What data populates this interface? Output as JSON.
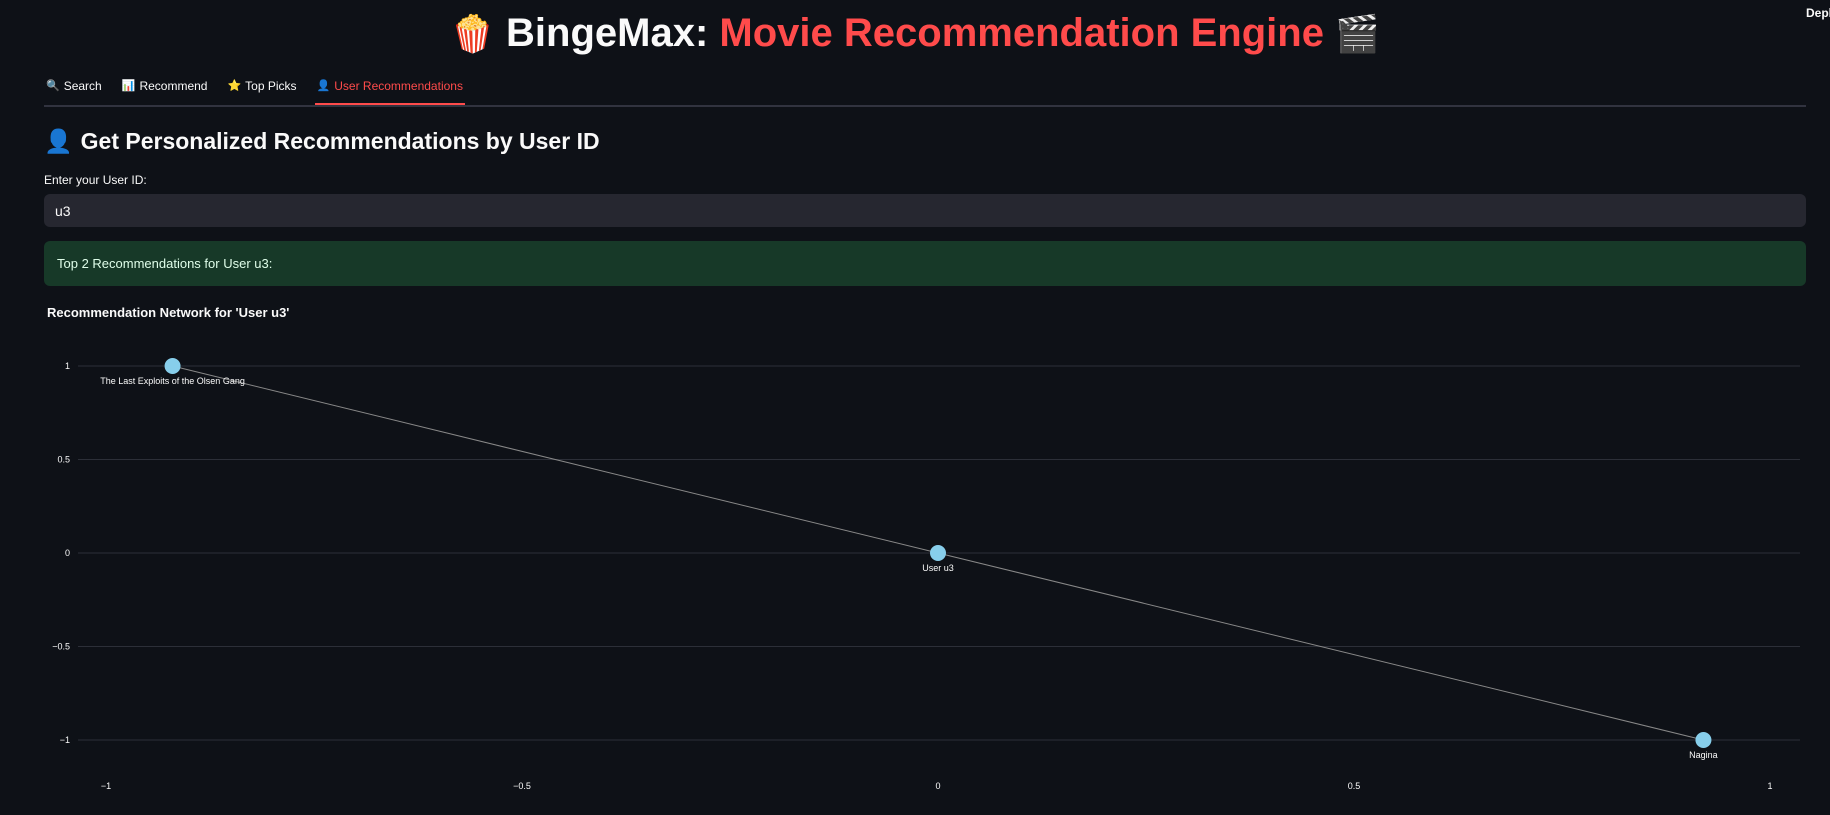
{
  "header": {
    "deploy_label": "Deploy",
    "title_emoji_left": "🍿",
    "title_part1": "BingeMax:",
    "title_part2": "Movie Recommendation Engine",
    "title_emoji_right": "🎬"
  },
  "tabs": [
    {
      "icon": "🔍",
      "label": "Search",
      "active": false
    },
    {
      "icon": "📊",
      "label": "Recommend",
      "active": false
    },
    {
      "icon": "⭐",
      "label": "Top Picks",
      "active": false
    },
    {
      "icon": "👤",
      "label": "User Recommendations",
      "active": true
    }
  ],
  "main": {
    "heading_icon": "👤",
    "heading": "Get Personalized Recommendations by User ID",
    "input_label": "Enter your User ID:",
    "input_value": "u3",
    "success_message": "Top 2 Recommendations for User u3:"
  },
  "colors": {
    "accent": "#ff4b4b",
    "node": "#87ceeb",
    "edge": "#888888",
    "success_bg": "#173928"
  },
  "chart_data": {
    "type": "scatter",
    "title": "Recommendation Network for 'User u3'",
    "xlim": [
      -1.05,
      1.05
    ],
    "ylim": [
      -1.1,
      1.2
    ],
    "x_ticks": [
      -1,
      -0.5,
      0,
      0.5,
      1
    ],
    "x_tick_labels": [
      "−1",
      "−0.5",
      "0",
      "0.5",
      "1"
    ],
    "y_ticks": [
      1,
      0.5,
      0,
      -0.5,
      -1
    ],
    "y_tick_labels": [
      "1",
      "0.5",
      "0",
      "−0.5",
      "−1"
    ],
    "grid": true,
    "nodes": [
      {
        "id": "movie1",
        "label": "The Last Exploits of the Olsen Gang",
        "x": -0.92,
        "y": 1
      },
      {
        "id": "user",
        "label": "User u3",
        "x": 0,
        "y": 0
      },
      {
        "id": "movie2",
        "label": "Nagina",
        "x": 0.92,
        "y": -1
      }
    ],
    "edges": [
      [
        "user",
        "movie1"
      ],
      [
        "user",
        "movie2"
      ]
    ]
  }
}
